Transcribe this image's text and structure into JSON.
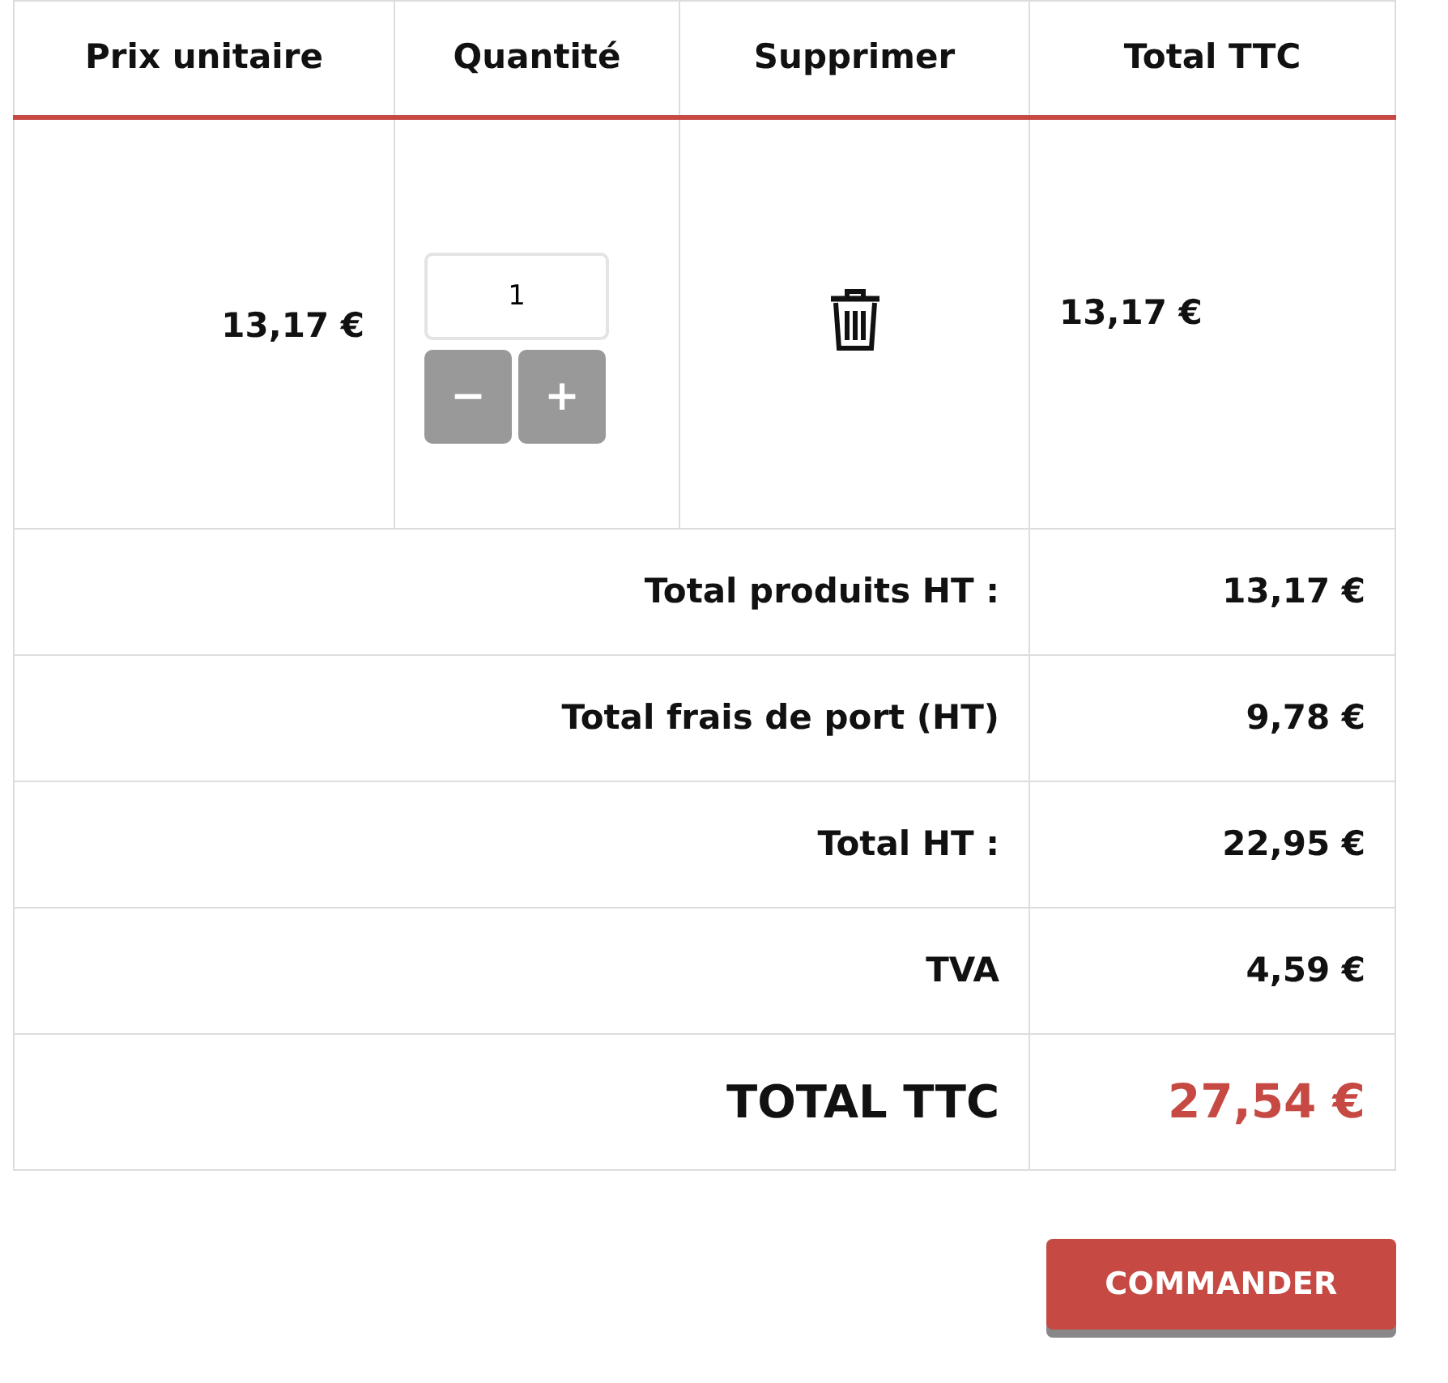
{
  "table": {
    "columns": [
      "Prix unitaire",
      "Quantité",
      "Supprimer",
      "Total TTC"
    ],
    "item": {
      "unit_price": "13,17 €",
      "quantity": "1",
      "decrease": "−",
      "increase": "+",
      "total": "13,17 €"
    },
    "summary": [
      {
        "label": "Total produits HT :",
        "value": "13,17 €",
        "kind": "normal"
      },
      {
        "label": "Total frais de port (HT)",
        "value": "9,78 €",
        "kind": "normal"
      },
      {
        "label": "Total HT :",
        "value": "22,95 €",
        "kind": "normal"
      },
      {
        "label": "TVA",
        "value": "4,59 €",
        "kind": "normal"
      },
      {
        "label": "TOTAL TTC",
        "value": "27,54 €",
        "kind": "grand"
      }
    ]
  },
  "order_button": "COMMANDER"
}
